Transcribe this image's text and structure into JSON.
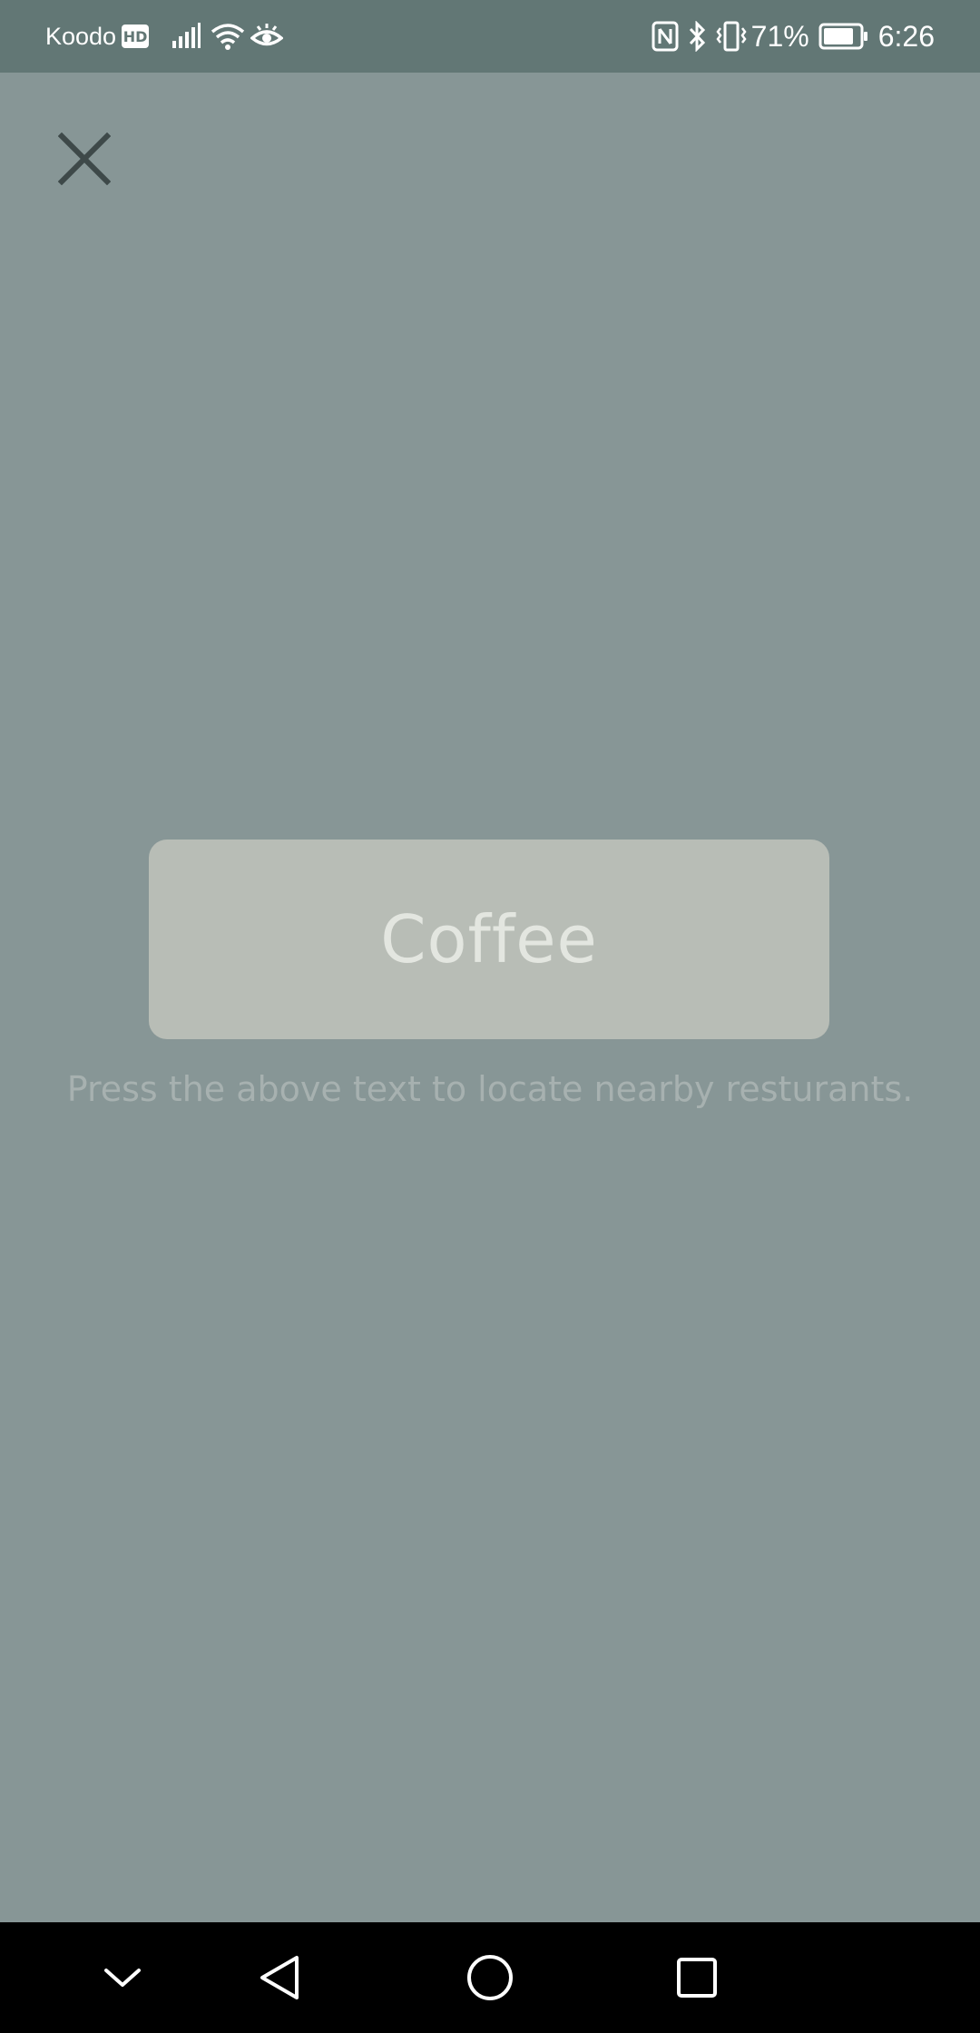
{
  "status_bar": {
    "carrier": "Koodo",
    "network_badge": "HD",
    "battery_percent": "71%",
    "time": "6:26",
    "icons": [
      "signal-icon",
      "wifi-icon",
      "eye-icon",
      "nfc-icon",
      "bluetooth-icon",
      "vibrate-icon",
      "battery-icon"
    ]
  },
  "dialog": {
    "close_icon": "close-icon",
    "main_button_label": "Coffee",
    "hint_text": "Press the above text to locate nearby resturants."
  },
  "nav_bar": {
    "icons": [
      "chevron-down-icon",
      "back-icon",
      "home-icon",
      "recents-icon"
    ]
  },
  "colors": {
    "background": "#879696",
    "status_bar": "#627775",
    "button": "#b8bdb6",
    "button_text": "#e3e6e0",
    "hint_text": "#a7b1b0",
    "nav_bar": "#000000"
  }
}
